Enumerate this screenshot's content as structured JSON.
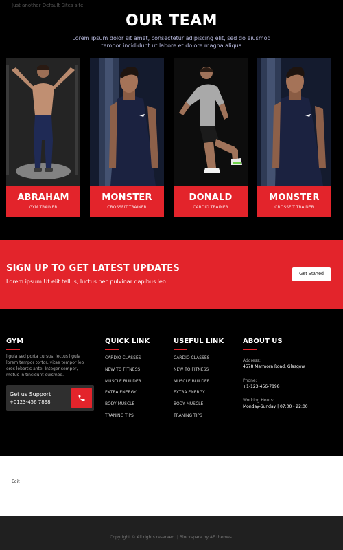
{
  "site": {
    "tagline": "Just another Default Sites site"
  },
  "team": {
    "title": "OUR TEAM",
    "subtitle": "Lorem ipsum dolor sit amet, consectetur adipiscing elit, sed do eiusmod tempor incididunt ut labore et dolore magna aliqua",
    "members": [
      {
        "name": "ABRAHAM",
        "role": "GYM TRAINER"
      },
      {
        "name": "MONSTER",
        "role": "CROSSFIT TRAINER"
      },
      {
        "name": "DONALD",
        "role": "CARDIO TRAINER"
      },
      {
        "name": "MONSTER",
        "role": "CROSSFIT TRAINER"
      }
    ]
  },
  "signup": {
    "title": "SIGN UP TO GET LATEST UPDATES",
    "text": "Lorem ipsum Ut elit tellus, luctus nec pulvinar dapibus leo.",
    "button": "Get Started"
  },
  "footer": {
    "gym": {
      "title": "GYM",
      "text": "ligula sed porta cursus, lectus ligula lorem tempor tortor, vitae tempor leo eros lobortis ante. Integer semper, metus in tincidunt euismod.",
      "support_title": "Get us Support",
      "support_number": "+0123-456 7898"
    },
    "quick_link": {
      "title": "QUICK LINK",
      "items": [
        "CARDIO CLASSES",
        "NEW TO FITNESS",
        "MUSCLE BUILDER",
        "EXTRA ENERGY",
        "BODY MUSCLE",
        "TRANING TIPS"
      ]
    },
    "useful_link": {
      "title": "USEFUL LINK",
      "items": [
        "CARDIO CLASSES",
        "NEW TO FITNESS",
        "MUSCLE BUILDER",
        "EXTRA ENERGY",
        "BODY MUSCLE",
        "TRANING TIPS"
      ]
    },
    "about": {
      "title": "ABOUT US",
      "address_label": "Address:",
      "address": "4578 Marmora Road, Glasgow",
      "phone_label": "Phone:",
      "phone": "+1-123-456-7898",
      "hours_label": "Working Hours:",
      "hours": "Monday-Sunday | 07:00 - 22:00"
    }
  },
  "edit_link": "Edit",
  "copyright": "Copyright © All rights reserved. | Blockspare by AF themes.",
  "colors": {
    "accent": "#e3242b",
    "background": "#000000",
    "support_box": "#2f2f2f",
    "bottom_bar": "#202020"
  }
}
